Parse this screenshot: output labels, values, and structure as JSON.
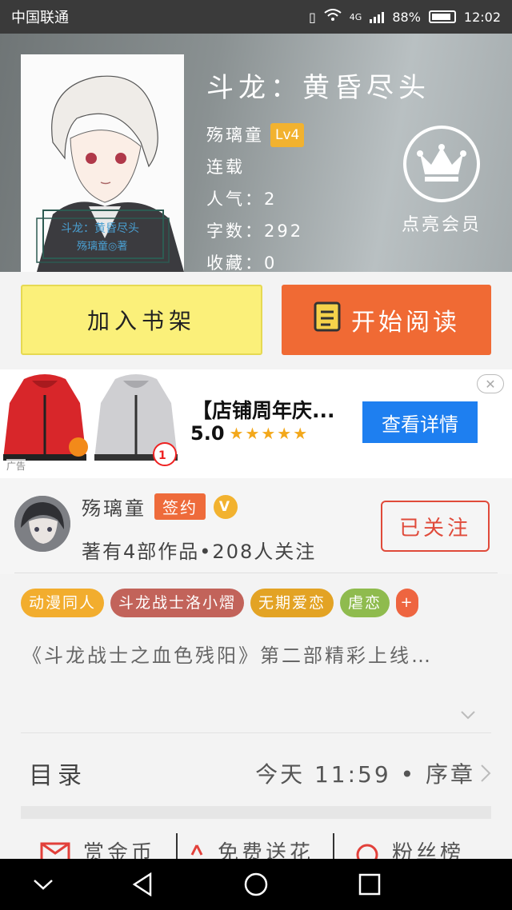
{
  "status_bar": {
    "carrier": "中国联通",
    "network": "4G",
    "battery": "88%",
    "battery_level": 0.88,
    "time": "12:02"
  },
  "book": {
    "title": "斗龙：黄昏尽头",
    "author": "殇璃童",
    "level": "Lv4",
    "status": "连载",
    "popularity": "人气：2",
    "word_count": "字数：292",
    "favorites": "收藏：0",
    "cover_text": "斗龙：黄昏尽头"
  },
  "vip": {
    "label": "点亮会员",
    "icon": "crown-icon"
  },
  "actions": {
    "add_shelf": "加入书架",
    "start_reading": "开始阅读"
  },
  "ad": {
    "title": "【店铺周年庆...",
    "rating": "5.0",
    "stars": "★★★★★",
    "cta": "查看详情",
    "tag": "广告",
    "close": "✕"
  },
  "author_card": {
    "name": "殇璃童",
    "sign_badge": "签约",
    "v_badge": "V",
    "stats": "著有4部作品•208人关注",
    "follow": "已关注"
  },
  "tags": [
    {
      "label": "动漫同人",
      "color": "#f2ad2e"
    },
    {
      "label": "斗龙战士洛小熠",
      "color": "#c2635a"
    },
    {
      "label": "无期爱恋",
      "color": "#e3a324"
    },
    {
      "label": "虐恋",
      "color": "#8fbb4e"
    },
    {
      "label": "+",
      "color": "#ee6540"
    }
  ],
  "description": "《斗龙战士之血色残阳》第二部精彩上线…",
  "toc": {
    "label": "目录",
    "latest": "今天 11:59 • 序章"
  },
  "bottom_actions": [
    {
      "label": "赏金币",
      "icon": "envelope-icon"
    },
    {
      "label": "免费送花",
      "icon": "flower-icon"
    },
    {
      "label": "粉丝榜",
      "icon": "ring-icon"
    }
  ],
  "colors": {
    "accent": "#f06a34",
    "shelf_button": "#fbf07a",
    "ad_button": "#1e7ff0",
    "follow": "#e04a3a"
  }
}
